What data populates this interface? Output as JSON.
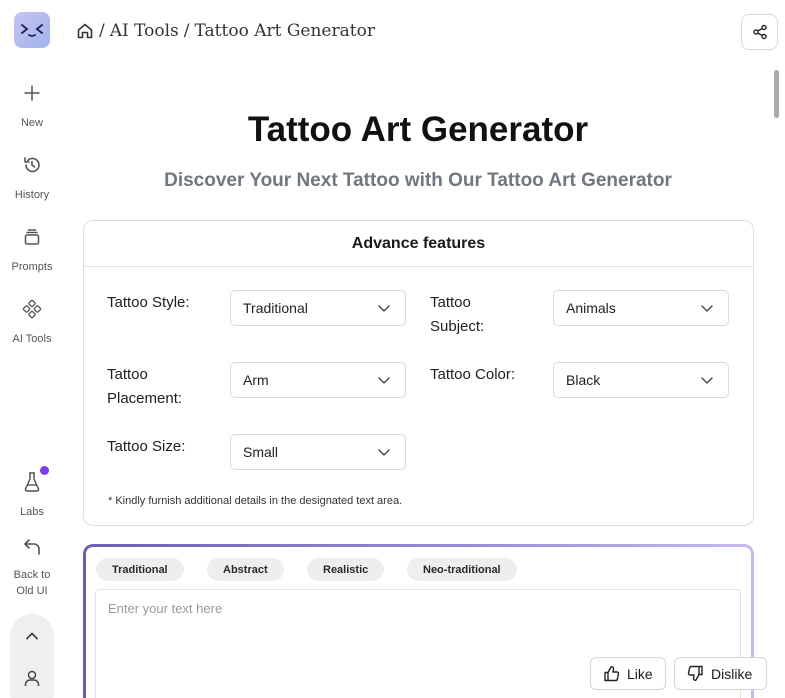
{
  "sidebar": {
    "items": [
      {
        "label": "New",
        "icon": "plus-icon"
      },
      {
        "label": "History",
        "icon": "history-icon"
      },
      {
        "label": "Prompts",
        "icon": "prompts-stack-icon"
      },
      {
        "label": "AI Tools",
        "icon": "ai-tools-icon"
      },
      {
        "label": "Labs",
        "icon": "flask-icon"
      },
      {
        "label_line1": "Back to",
        "label_line2": "Old UI",
        "icon": "back-arrow-icon"
      }
    ],
    "badge_color": "#7a3fe4"
  },
  "breadcrumb": {
    "home_icon": "home-icon",
    "items": [
      "AI Tools",
      "Tattoo Art Generator"
    ],
    "separator": "/"
  },
  "page": {
    "title": "Tattoo Art Generator",
    "subtitle": "Discover Your Next Tattoo with Our Tattoo Art Generator"
  },
  "features": {
    "heading": "Advance features",
    "style": {
      "label": "Tattoo Style:",
      "value": "Traditional"
    },
    "subject": {
      "label_line1": "Tattoo",
      "label_line2": "Subject:",
      "value": "Animals"
    },
    "placement": {
      "label_line1": "Tattoo",
      "label_line2": "Placement:",
      "value": "Arm"
    },
    "color": {
      "label": "Tattoo Color:",
      "value": "Black"
    },
    "size": {
      "label": "Tattoo Size:",
      "value": "Small"
    },
    "note": "* Kindly furnish additional details in the designated text area."
  },
  "prompt": {
    "chips": [
      "Traditional",
      "Abstract",
      "Realistic",
      "Neo-traditional"
    ],
    "placeholder": "Enter your text here",
    "like_label": "Like",
    "dislike_label": "Dislike"
  }
}
